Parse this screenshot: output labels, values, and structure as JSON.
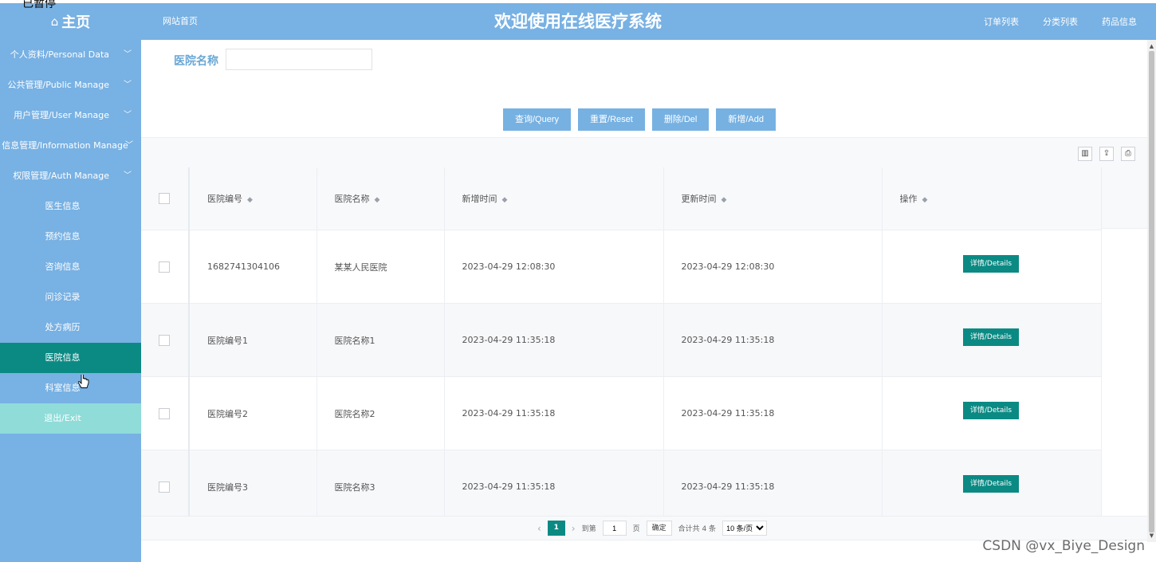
{
  "overlay": {
    "paused_text": "已暂停"
  },
  "header": {
    "brand": "主页",
    "site_home": "网站首页",
    "title": "欢迎使用在线医疗系统",
    "links": [
      "订单列表",
      "分类列表",
      "药品信息"
    ]
  },
  "sidebar": {
    "groups": [
      "个人资料/Personal Data",
      "公共管理/Public Manage",
      "用户管理/User Manage",
      "信息管理/Information Manage",
      "权限管理/Auth Manage"
    ],
    "subs": [
      "医生信息",
      "预约信息",
      "咨询信息",
      "问诊记录",
      "处方病历",
      "医院信息",
      "科室信息"
    ],
    "exit": "退出/Exit",
    "active": "医院信息"
  },
  "search": {
    "label": "医院名称",
    "value": ""
  },
  "buttons": {
    "query": "查询/Query",
    "reset": "重置/Reset",
    "delete": "删除/Del",
    "add": "新增/Add"
  },
  "table": {
    "headers": [
      "医院编号",
      "医院名称",
      "新增时间",
      "更新时间",
      "操作"
    ],
    "rows": [
      {
        "code": "1682741304106",
        "name": "某某人民医院",
        "created": "2023-04-29 12:08:30",
        "updated": "2023-04-29 12:08:30"
      },
      {
        "code": "医院编号1",
        "name": "医院名称1",
        "created": "2023-04-29 11:35:18",
        "updated": "2023-04-29 11:35:18"
      },
      {
        "code": "医院编号2",
        "name": "医院名称2",
        "created": "2023-04-29 11:35:18",
        "updated": "2023-04-29 11:35:18"
      },
      {
        "code": "医院编号3",
        "name": "医院名称3",
        "created": "2023-04-29 11:35:18",
        "updated": "2023-04-29 11:35:18"
      }
    ],
    "detail_label": "详情/Details"
  },
  "pager": {
    "current": "1",
    "goto_prefix": "到第",
    "goto_value": "1",
    "goto_suffix": "页",
    "confirm": "确定",
    "total": "合计共 4 条",
    "page_size": "10 条/页"
  },
  "watermark": "CSDN @vx_Biye_Design",
  "colors": {
    "primary": "#78b1e3",
    "accent": "#0b8a84",
    "exit": "#8fdcd9"
  }
}
